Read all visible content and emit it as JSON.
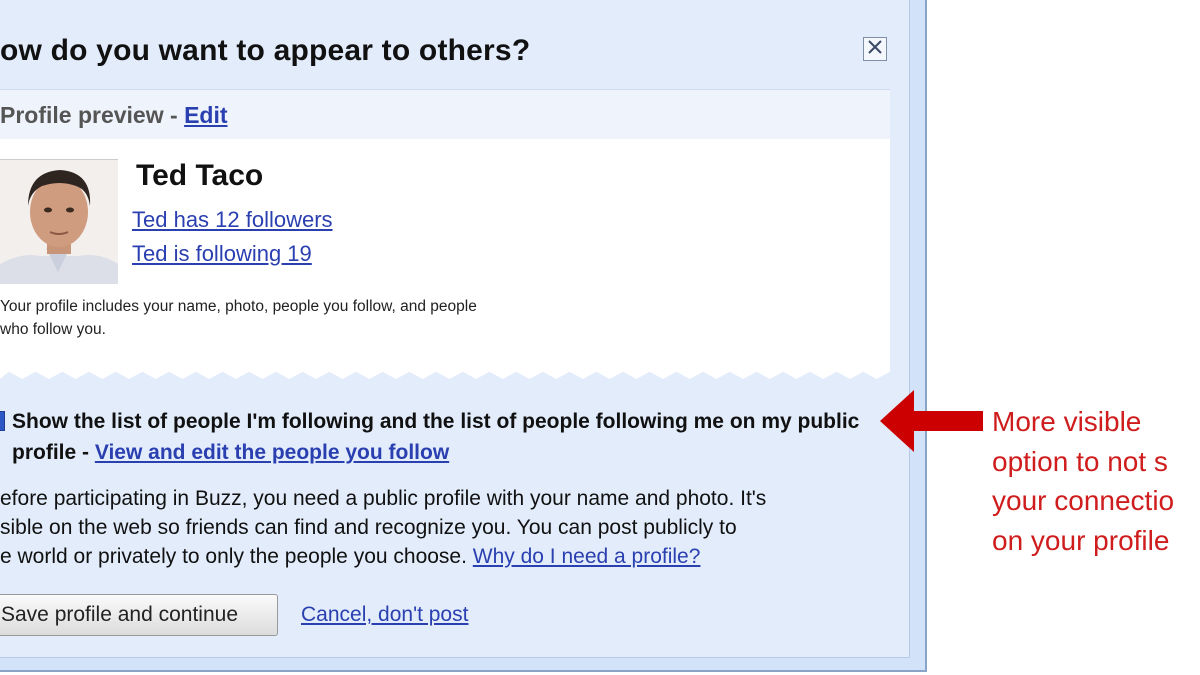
{
  "dialog": {
    "title": "ow do you want to appear to others?",
    "close_icon": "close-x-icon"
  },
  "preview": {
    "label": "Profile preview - ",
    "edit_link": "Edit"
  },
  "profile": {
    "name": "Ted Taco",
    "followers_link": "Ted has 12 followers",
    "following_link": "Ted is following 19",
    "note_line1": "Your profile includes your name, photo, people you follow, and people",
    "note_line2": "who follow you."
  },
  "option": {
    "checked": true,
    "text": "Show the list of people I'm following and the list of people following me on my public profile - ",
    "link": "View and edit the people you follow"
  },
  "info": {
    "line1": "efore participating in Buzz, you need a public profile with your name and photo. It's",
    "line2": "sible on the web so friends can find and recognize you. You can post publicly to",
    "line3": "e world or privately to only the people you choose. ",
    "link": "Why do I need a profile?"
  },
  "actions": {
    "save_label": "Save profile and continue",
    "cancel_label": "Cancel, don't post"
  },
  "annotation": {
    "text": "More visible\noption to not s\nyour connectio\non your profile",
    "arrow_icon": "left-arrow-icon",
    "color": "#cf1c1c"
  }
}
